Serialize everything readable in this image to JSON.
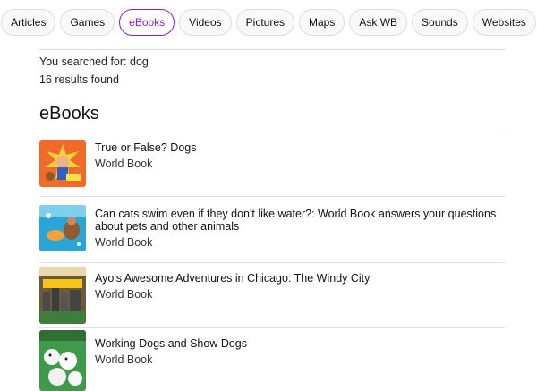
{
  "tabs": [
    {
      "label": "Articles"
    },
    {
      "label": "Games"
    },
    {
      "label": "eBooks",
      "active": true
    },
    {
      "label": "Videos"
    },
    {
      "label": "Pictures"
    },
    {
      "label": "Maps"
    },
    {
      "label": "Ask WB"
    },
    {
      "label": "Sounds"
    },
    {
      "label": "Websites"
    }
  ],
  "search": {
    "summary": "You searched for: dog",
    "count": "16 results found"
  },
  "section": {
    "title": "eBooks"
  },
  "results": [
    {
      "title": "True or False? Dogs",
      "publisher": "World Book",
      "icon": "ebook-cover-true-or-false-dogs"
    },
    {
      "title": "Can cats swim even if they don't like water?: World Book answers your questions about pets and other animals",
      "publisher": "World Book",
      "icon": "ebook-cover-can-cats-swim"
    },
    {
      "title": "Ayo's Awesome Adventures in Chicago: The Windy City",
      "publisher": "World Book",
      "icon": "ebook-cover-ayo-chicago"
    },
    {
      "title": "Working Dogs and Show Dogs",
      "publisher": "World Book",
      "icon": "ebook-cover-working-dogs"
    }
  ],
  "colors": {
    "accent": "#8a1bd8",
    "divider": "#dddddd"
  }
}
